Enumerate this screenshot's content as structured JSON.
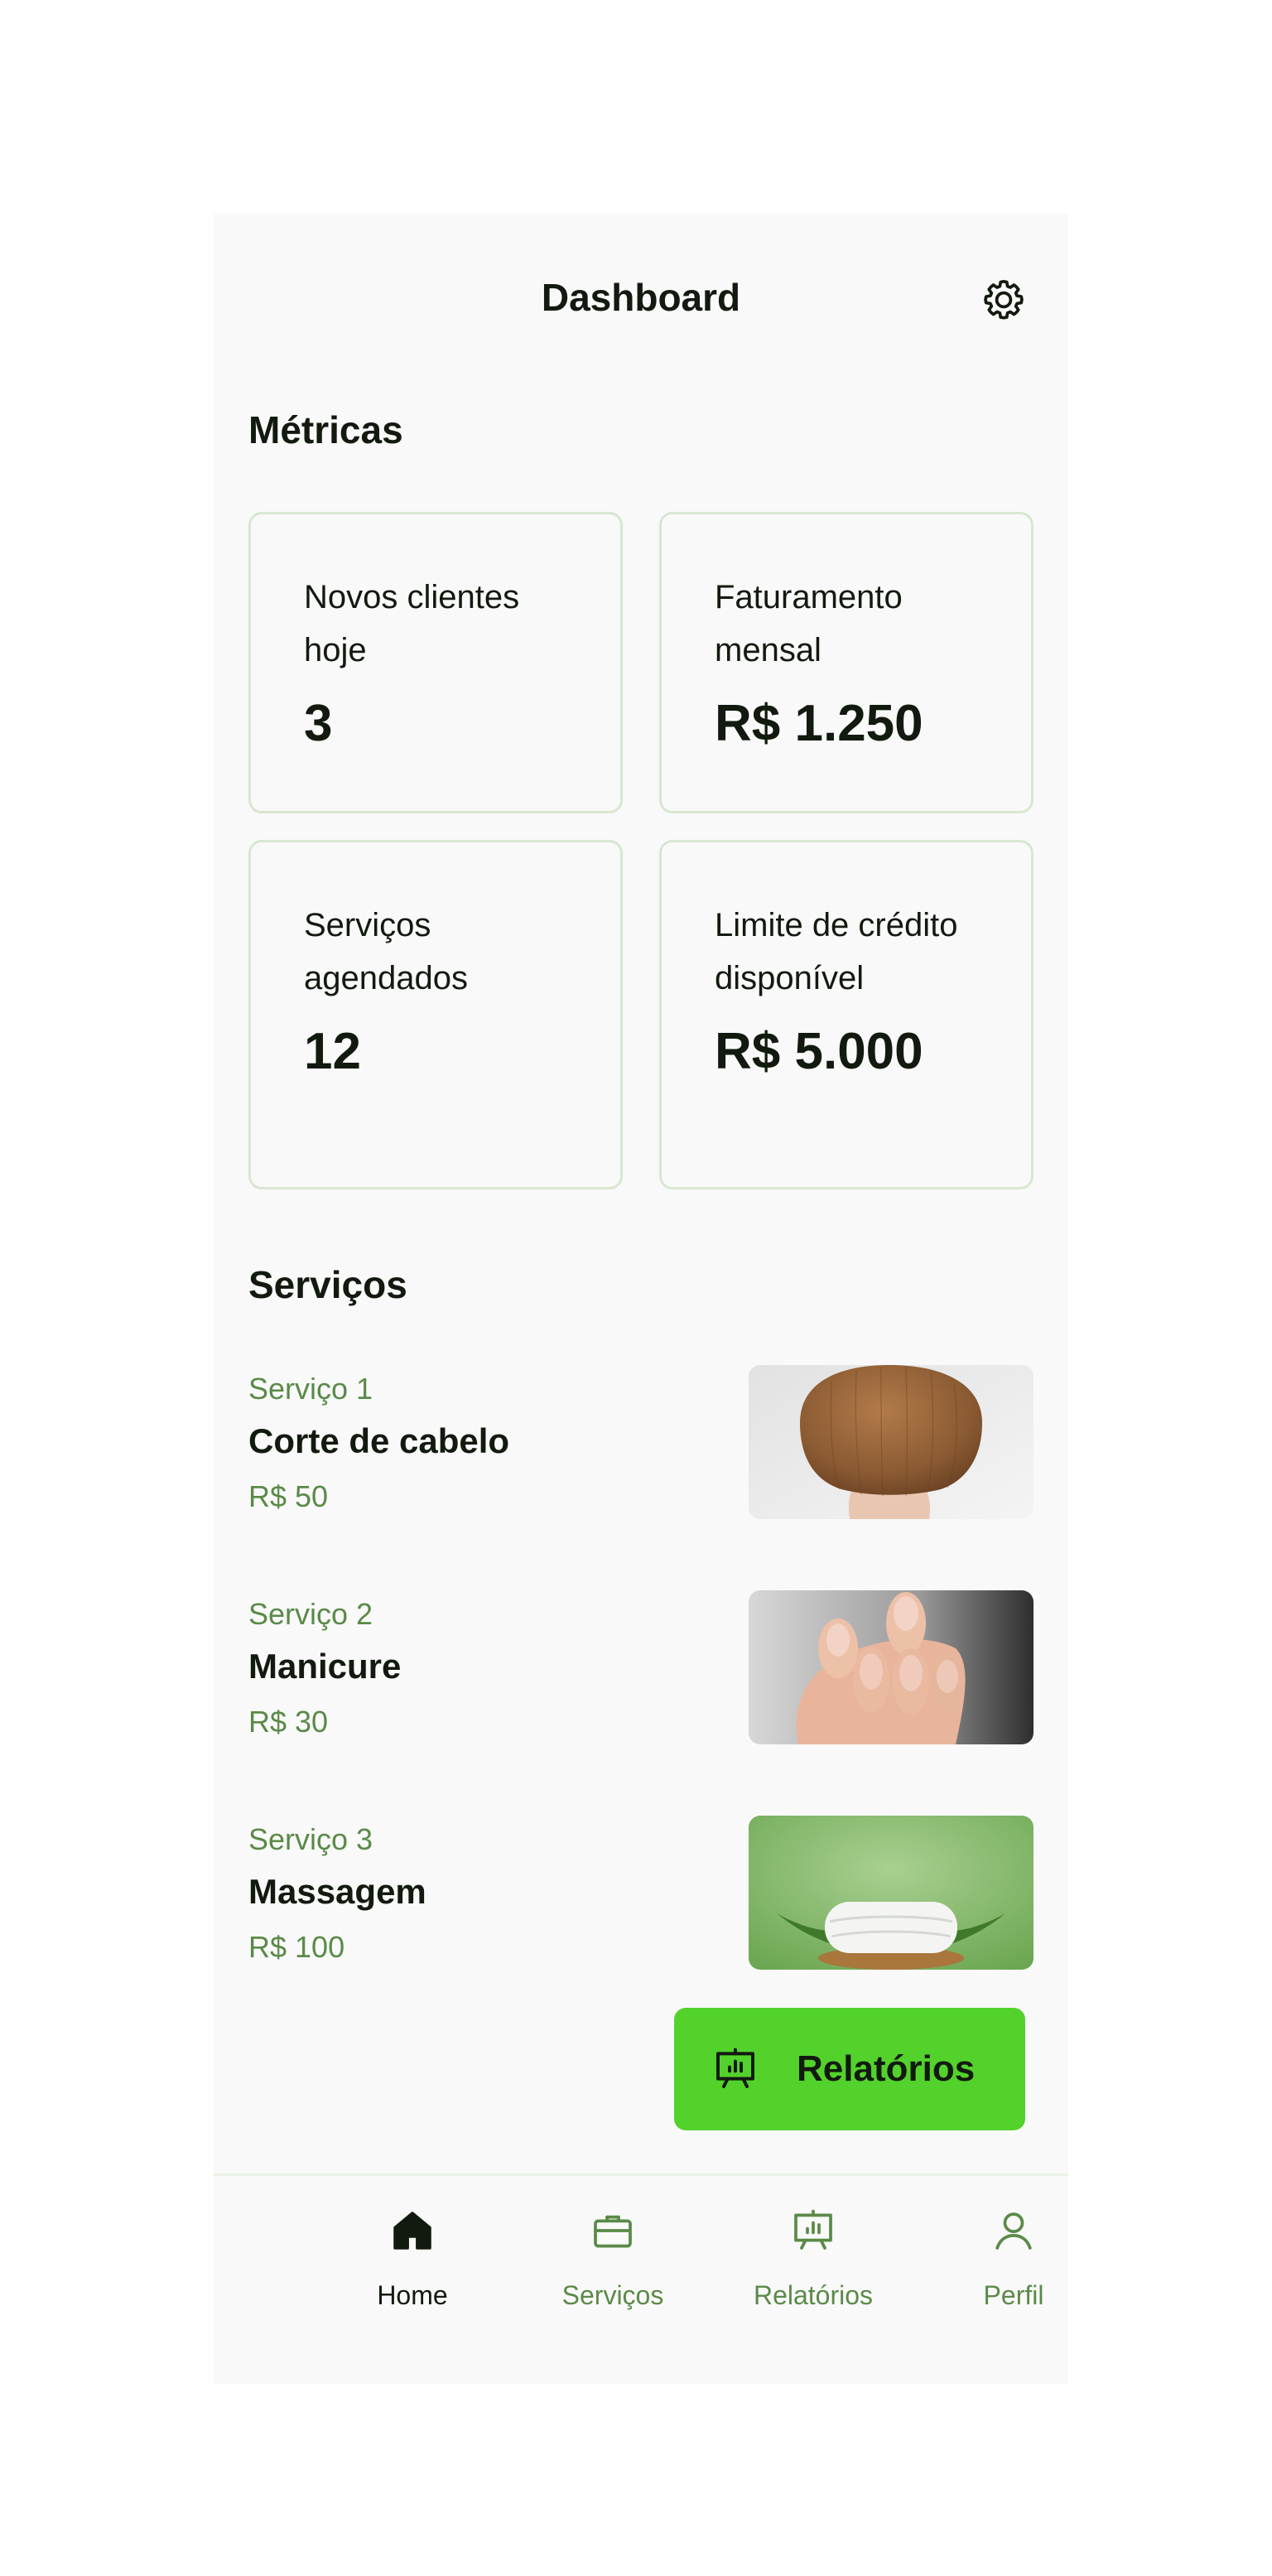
{
  "header": {
    "title": "Dashboard"
  },
  "metrics": {
    "title": "Métricas",
    "cards": [
      {
        "label": "Novos clientes hoje",
        "value": "3"
      },
      {
        "label": "Faturamento mensal",
        "value": "R$ 1.250"
      },
      {
        "label": "Serviços agendados",
        "value": "12"
      },
      {
        "label": "Limite de crédito disponível",
        "value": "R$ 5.000"
      }
    ]
  },
  "services": {
    "title": "Serviços",
    "items": [
      {
        "number": "Serviço 1",
        "name": "Corte de cabelo",
        "price": "R$ 50"
      },
      {
        "number": "Serviço 2",
        "name": "Manicure",
        "price": "R$ 30"
      },
      {
        "number": "Serviço 3",
        "name": "Massagem",
        "price": "R$ 100"
      }
    ]
  },
  "fab": {
    "label": "Relatórios",
    "icon": "presentation-chart-icon"
  },
  "nav": {
    "items": [
      {
        "label": "Home",
        "icon": "house-icon"
      },
      {
        "label": "Serviços",
        "icon": "briefcase-icon"
      },
      {
        "label": "Relatórios",
        "icon": "presentation-chart-icon"
      },
      {
        "label": "Perfil",
        "icon": "user-icon"
      }
    ]
  },
  "colors": {
    "accent": "#53d22c",
    "muted_green": "#5a8a48",
    "text": "#121a0f",
    "background": "#f9f9f9",
    "border": "#d8e6d2"
  }
}
